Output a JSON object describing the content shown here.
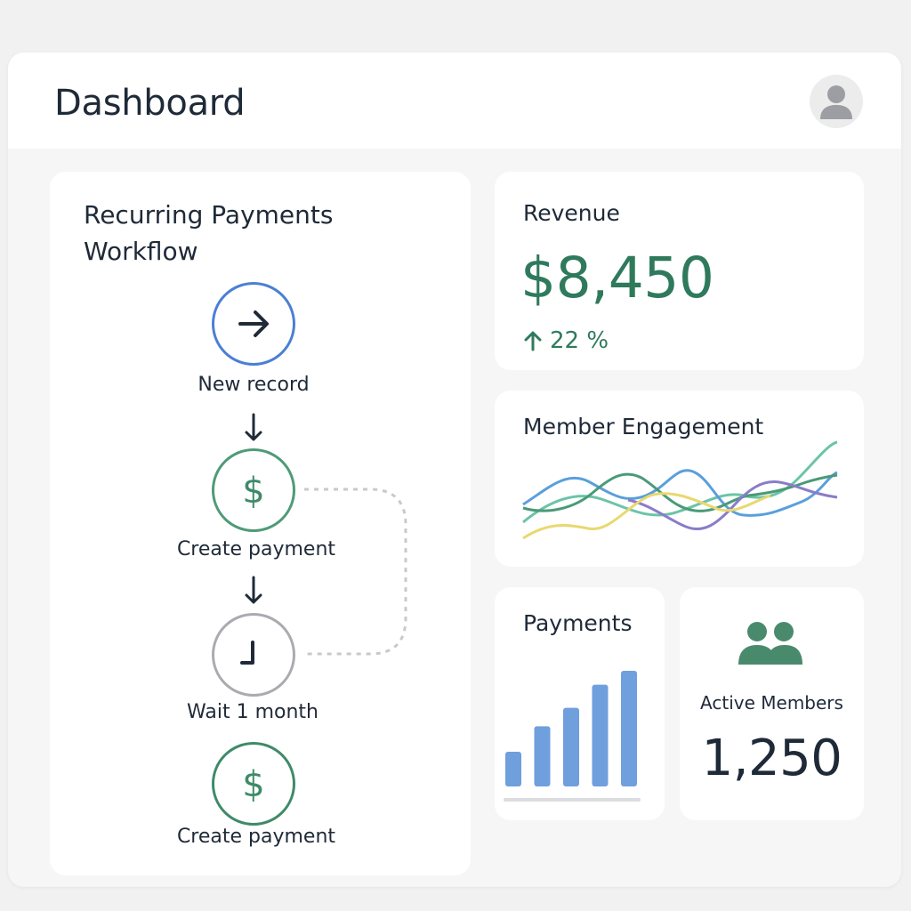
{
  "header": {
    "title": "Dashboard",
    "avatar_icon": "user-avatar-icon"
  },
  "workflow": {
    "title": "Recurring Payments Workflow",
    "steps": [
      {
        "label": "New record",
        "icon": "arrow-right-icon",
        "color": "#4a7fd4"
      },
      {
        "label": "Create payment",
        "icon": "dollar-icon",
        "color": "#4f9a78"
      },
      {
        "label": "Wait 1 month",
        "icon": "clock-icon",
        "color": "#a9abb0"
      },
      {
        "label": "Create payment",
        "icon": "dollar-icon",
        "color": "#3f8a68"
      }
    ]
  },
  "revenue": {
    "title": "Revenue",
    "value": "$8,450",
    "change": "22 %",
    "change_icon": "arrow-up-icon",
    "color": "#2f7a5c"
  },
  "engagement": {
    "title": "Member Engagement",
    "colors": [
      "#6cc4a8",
      "#5a9fdc",
      "#4a9a78",
      "#8a7cc8",
      "#e8d870"
    ]
  },
  "payments": {
    "title": "Payments",
    "bar_color": "#6f9fdc",
    "bar_levels": [
      0.3,
      0.52,
      0.68,
      0.88,
      1.0
    ]
  },
  "members": {
    "label": "Active Members",
    "value": "1,250",
    "icon": "members-icon",
    "color": "#4a8a6c"
  }
}
